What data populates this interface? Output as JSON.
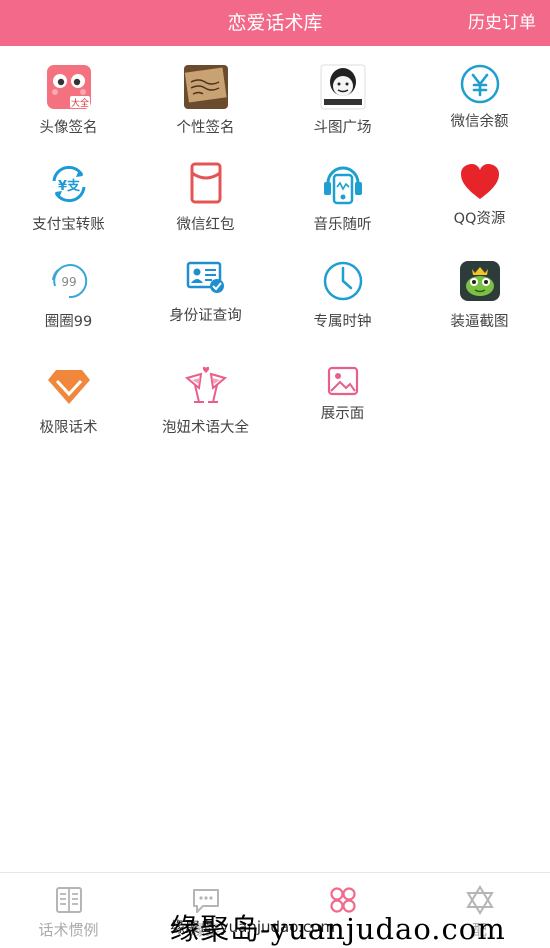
{
  "header": {
    "title": "恋爱话术库",
    "history_label": "历史订单"
  },
  "grid": [
    {
      "label": "头像签名",
      "icon": "avatar-face-icon",
      "badge": "大全"
    },
    {
      "label": "个性签名",
      "icon": "signature-photo-icon"
    },
    {
      "label": "斗图广场",
      "icon": "meme-face-icon"
    },
    {
      "label": "微信余额",
      "icon": "yen-circle-icon"
    },
    {
      "label": "支付宝转账",
      "icon": "alipay-transfer-icon"
    },
    {
      "label": "微信红包",
      "icon": "red-envelope-icon"
    },
    {
      "label": "音乐随听",
      "icon": "music-player-icon"
    },
    {
      "label": "QQ资源",
      "icon": "heart-icon"
    },
    {
      "label": "圈圈99",
      "icon": "circle-99-icon",
      "badge": "99"
    },
    {
      "label": "身份证查询",
      "icon": "id-card-icon"
    },
    {
      "label": "专属时钟",
      "icon": "clock-icon"
    },
    {
      "label": "装逼截图",
      "icon": "frog-crown-icon"
    },
    {
      "label": "极限话术",
      "icon": "diamond-icon"
    },
    {
      "label": "泡妞术语大全",
      "icon": "cocktail-glasses-icon"
    },
    {
      "label": "展示面",
      "icon": "image-icon"
    }
  ],
  "tabs": [
    {
      "label": "话术惯例",
      "icon": "document-icon",
      "active": false
    },
    {
      "label": "缘聚",
      "icon": "chat-bubble-icon",
      "active": false
    },
    {
      "label": "",
      "icon": "grid-flower-icon",
      "active": true
    },
    {
      "label": "配",
      "icon": "star-of-david-icon",
      "active": false
    }
  ],
  "watermark": {
    "text": "缘聚岛-yuanjudao.com",
    "small": "缘聚岛 yuanjudao.com"
  },
  "colors": {
    "brand": "#f2698a",
    "inactive": "#aaaaaa"
  }
}
